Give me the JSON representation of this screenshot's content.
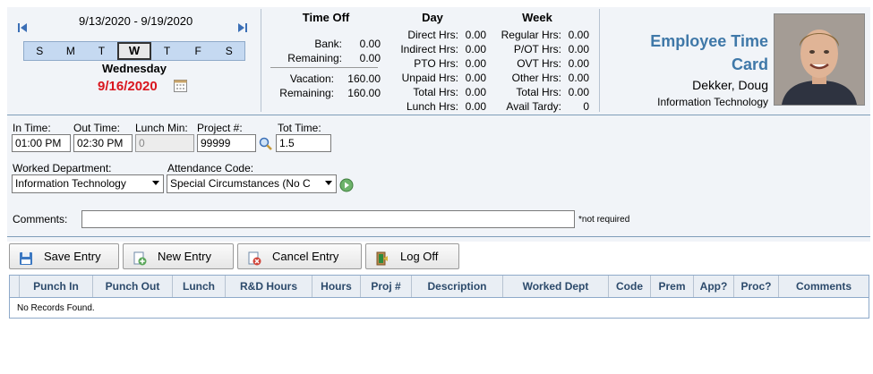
{
  "week": {
    "range": "9/13/2020 - 9/19/2020",
    "days": [
      "S",
      "M",
      "T",
      "W",
      "T",
      "F",
      "S"
    ],
    "selected_index": 3,
    "selected_day_name": "Wednesday",
    "selected_date": "9/16/2020"
  },
  "time_off": {
    "title": "Time Off",
    "rows": [
      {
        "label": "Bank:",
        "value": "0.00"
      },
      {
        "label": "Remaining:",
        "value": "0.00"
      },
      {
        "label": "Vacation:",
        "value": "160.00"
      },
      {
        "label": "Remaining:",
        "value": "160.00"
      }
    ]
  },
  "day_totals": {
    "title": "Day",
    "rows": [
      {
        "label": "Direct Hrs:",
        "value": "0.00"
      },
      {
        "label": "Indirect Hrs:",
        "value": "0.00"
      },
      {
        "label": "PTO Hrs:",
        "value": "0.00"
      },
      {
        "label": "Unpaid Hrs:",
        "value": "0.00"
      },
      {
        "label": "Total Hrs:",
        "value": "0.00"
      },
      {
        "label": "Lunch Hrs:",
        "value": "0.00"
      }
    ]
  },
  "week_totals": {
    "title": "Week",
    "rows": [
      {
        "label": "Regular Hrs:",
        "value": "0.00"
      },
      {
        "label": "P/OT Hrs:",
        "value": "0.00"
      },
      {
        "label": "OVT Hrs:",
        "value": "0.00"
      },
      {
        "label": "Other Hrs:",
        "value": "0.00"
      },
      {
        "label": "Total Hrs:",
        "value": "0.00"
      },
      {
        "label": "Avail Tardy:",
        "value": "0"
      }
    ]
  },
  "employee": {
    "card_title_line1": "Employee Time",
    "card_title_line2": "Card",
    "name": "Dekker, Doug",
    "department": "Information Technology"
  },
  "form": {
    "in_time_label": "In Time:",
    "in_time_value": "01:00 PM",
    "out_time_label": "Out Time:",
    "out_time_value": "02:30 PM",
    "lunch_label": "Lunch Min:",
    "lunch_value": "0",
    "project_label": "Project #:",
    "project_value": "99999",
    "tot_label": "Tot Time:",
    "tot_value": "1.5",
    "worked_dept_label": "Worked Department:",
    "worked_dept_value": "Information Technology",
    "attendance_label": "Attendance Code:",
    "attendance_value": "Special Circumstances (No C",
    "comments_label": "Comments:",
    "comments_value": "",
    "comments_note": "*not required"
  },
  "buttons": {
    "save": "Save Entry",
    "new": "New Entry",
    "cancel": "Cancel Entry",
    "logoff": "Log Off"
  },
  "grid": {
    "columns": [
      "Punch In",
      "Punch Out",
      "Lunch",
      "R&D Hours",
      "Hours",
      "Proj #",
      "Description",
      "Worked Dept",
      "Code",
      "Prem",
      "App?",
      "Proc?",
      "Comments"
    ],
    "empty_text": "No Records Found."
  },
  "colors": {
    "selected_date": "#d9161e",
    "card_title": "#3f78a8",
    "header_text": "#2c4a6b",
    "panel_bg": "#f1f4f8",
    "day_strip": "#c5d9f1"
  }
}
